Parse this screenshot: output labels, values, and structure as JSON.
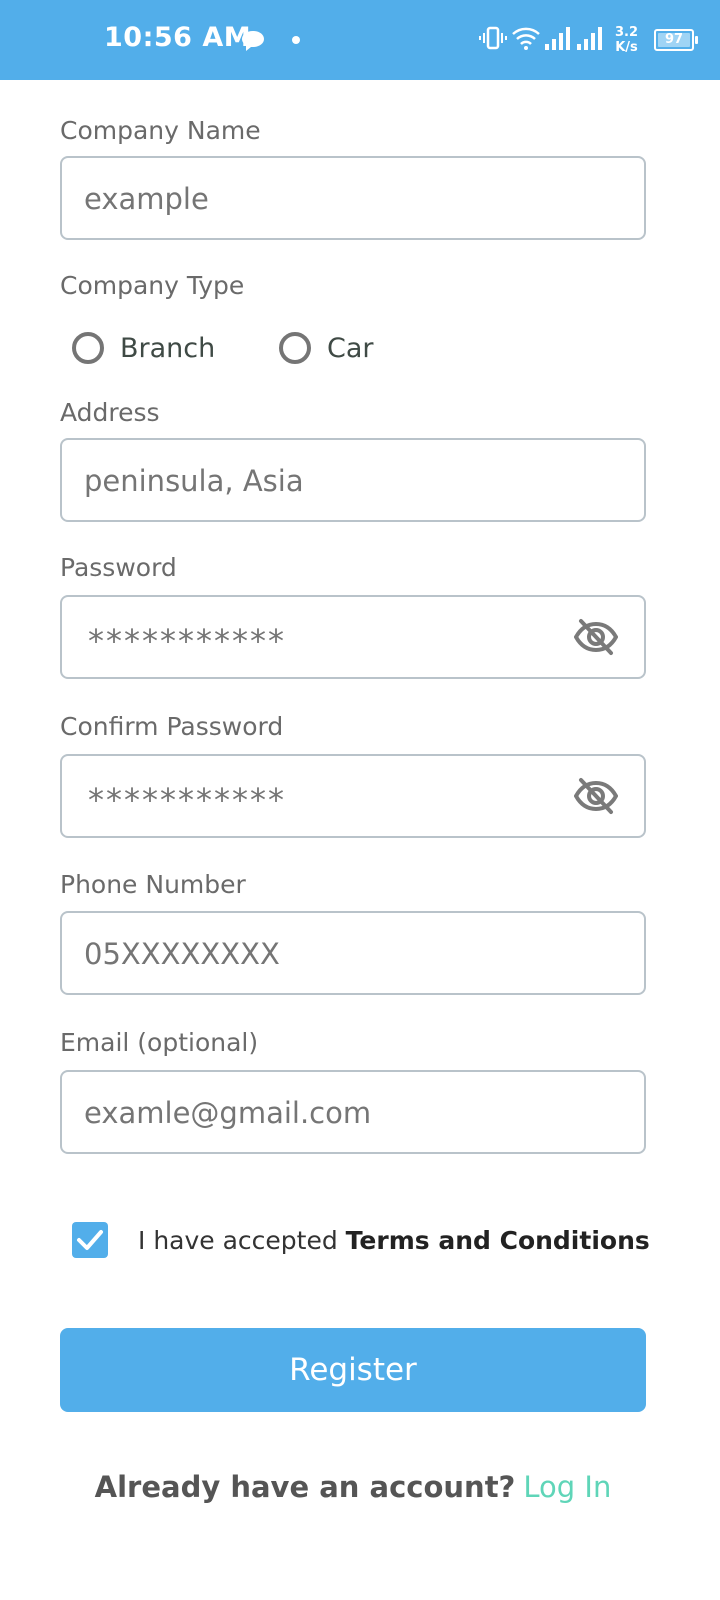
{
  "status_bar": {
    "time": "10:56 AM",
    "network_speed_value": "3.2",
    "network_speed_unit": "K/s",
    "battery": "97"
  },
  "form": {
    "company_name": {
      "label": "Company Name",
      "value": "example"
    },
    "company_type": {
      "label": "Company Type",
      "options": [
        "Branch",
        "Car"
      ],
      "selected": null
    },
    "address": {
      "label": "Address",
      "value": "peninsula, Asia"
    },
    "password": {
      "label": "Password",
      "value": "***********"
    },
    "confirm_password": {
      "label": "Confirm Password",
      "value": "***********"
    },
    "phone": {
      "label": "Phone Number",
      "value": "05XXXXXXXX"
    },
    "email": {
      "label": "Email (optional)",
      "value": "examle@gmail.com"
    },
    "terms": {
      "checked": true,
      "prefix": "I have accepted ",
      "link": "Terms and Conditions"
    },
    "register_label": "Register"
  },
  "footer": {
    "question": "Already have an account?",
    "login_label": "Log In"
  },
  "colors": {
    "primary": "#52aeea",
    "link_green": "#5fd5b8"
  }
}
